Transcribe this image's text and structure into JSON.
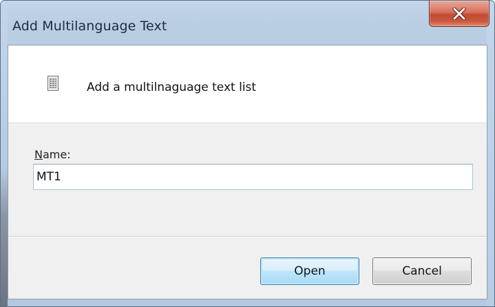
{
  "window": {
    "title": "Add Multilanguage Text",
    "close_icon": "close-icon"
  },
  "header": {
    "icon": "document-icon",
    "text": "Add a multilnaguage text list"
  },
  "form": {
    "name_label_access_key": "N",
    "name_label_rest": "ame:",
    "name_value": "MT1"
  },
  "buttons": {
    "open_label": "Open",
    "cancel_label": "Cancel"
  },
  "colors": {
    "frame": "#b9cde3",
    "close_button": "#c8573d",
    "default_button_border": "#3c7fb1"
  }
}
